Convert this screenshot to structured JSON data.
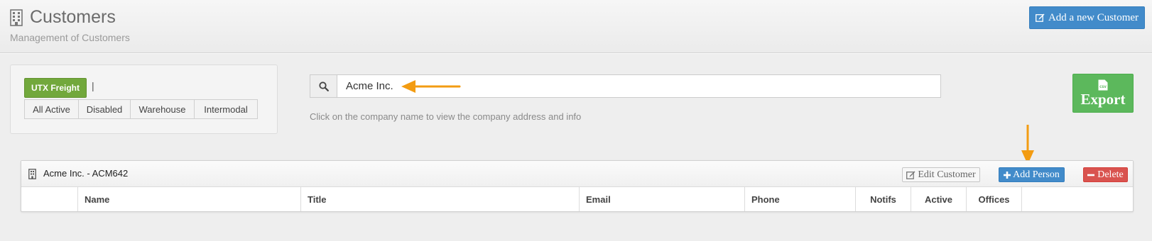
{
  "header": {
    "title": "Customers",
    "subtitle": "Management of Customers",
    "add_button_label": "Add a new Customer",
    "title_icon": "building-icon"
  },
  "filters": {
    "group_button": "UTX Freight",
    "separator": "|",
    "options": [
      "All Active",
      "Disabled",
      "Warehouse",
      "Intermodal"
    ]
  },
  "search": {
    "value": "Acme Inc.",
    "icon": "search-icon",
    "hint": "Click on the company name to view the company address and info"
  },
  "export": {
    "icon_text": "CSV",
    "label": "Export"
  },
  "customer": {
    "name": "Acme Inc. - ACM642",
    "edit_label": "Edit Customer",
    "add_person_label": "Add Person",
    "delete_label": "Delete",
    "columns": [
      "",
      "Name",
      "Title",
      "Email",
      "Phone",
      "Notifs",
      "Active",
      "Offices",
      ""
    ]
  },
  "colors": {
    "primary": "#428bca",
    "success": "#5cb85c",
    "group_green": "#72a83c",
    "danger": "#d9534f",
    "annotation_arrow": "#f39c12"
  }
}
